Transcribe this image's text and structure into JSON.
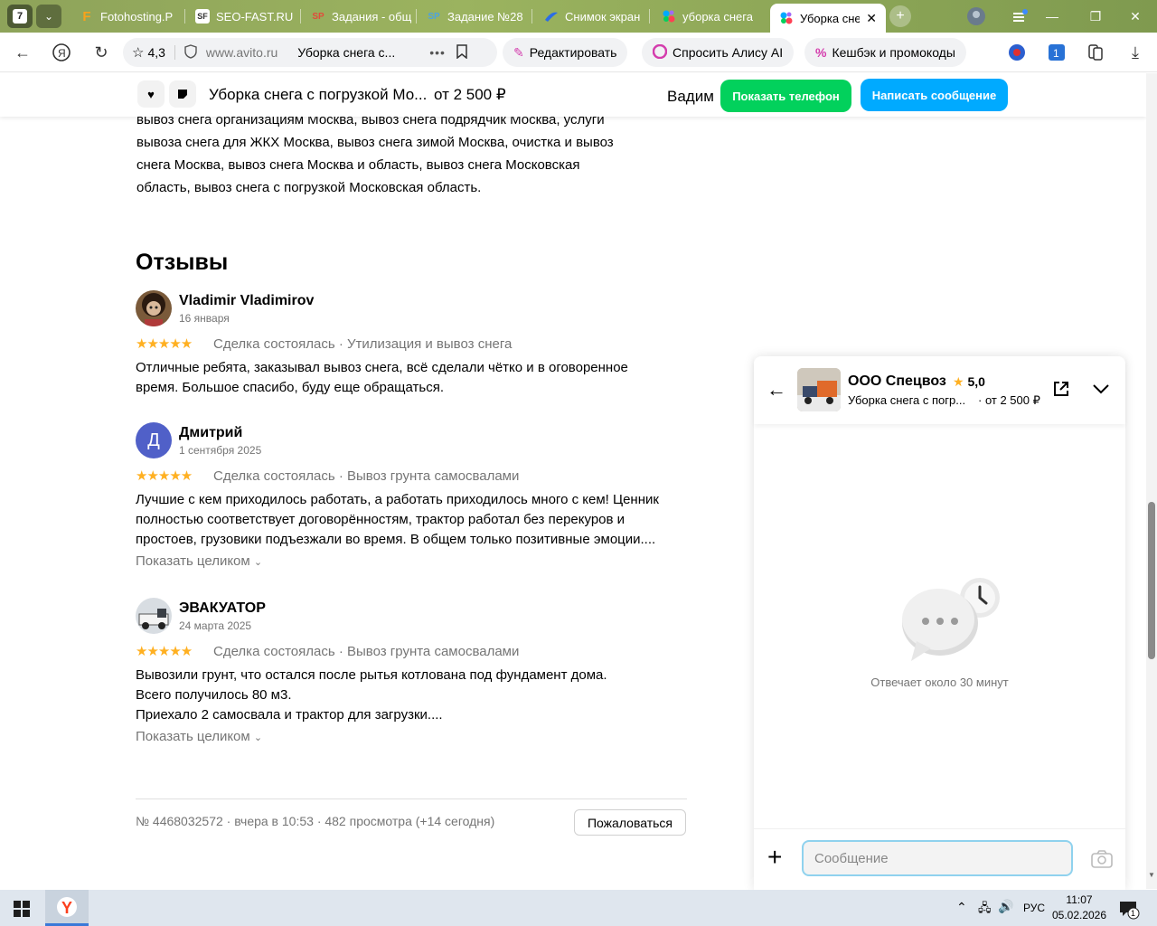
{
  "browser": {
    "tab_count": "7",
    "tabs": [
      {
        "title": "Fotohosting.P",
        "fav": "F",
        "fav_color": "#f7a21b"
      },
      {
        "title": "SEO-FAST.RU",
        "fav": "SF",
        "fav_color": "#ffffff"
      },
      {
        "title": "Задания - общ",
        "fav": "SP",
        "fav_color": "#e24b3b"
      },
      {
        "title": "Задание №28",
        "fav": "SP",
        "fav_color": "#4da3e0"
      },
      {
        "title": "Снимок экран",
        "fav": "",
        "fav_color": "#2b6de6"
      },
      {
        "title": "уборка снега",
        "fav": "",
        "fav_color": "#ffffff"
      },
      {
        "title": "Уборка сне",
        "fav": "",
        "fav_color": "#ffffff"
      }
    ],
    "rating": "4,3",
    "url": "www.avito.ru",
    "page_title": "Уборка снега с...",
    "edit_label": "Редактировать",
    "alice_label": "Спросить Алису AI",
    "cashback_label": "Кешбэк и промокоды"
  },
  "sticky": {
    "title": "Уборка снега с погрузкой Мо...",
    "price": "от 2 500 ₽",
    "seller": "Вадим",
    "show_phone": "Показать телефон",
    "write_message": "Написать сообщение"
  },
  "description": {
    "lines": [
      "вывоз снега организациям Москва, вывоз снега подрядчик Москва, услуги",
      "вывоза снега для ЖКХ Москва, вывоз снега зимой Москва, очистка и вывоз",
      "снега Москва, вывоз снега Москва и область, вывоз снега Московская",
      "область, вывоз снега с погрузкой Московская область."
    ]
  },
  "reviews": {
    "title": "Отзывы",
    "stars": "★★★★★",
    "show_more": "Показать целиком",
    "items": [
      {
        "name": "Vladimir Vladimirov",
        "date": "16 января",
        "deal": "Сделка состоялась · Утилизация и вывоз снега",
        "text": [
          "Отличные ребята, заказывал вывоз снега, всё сделали чётко и в оговоренное",
          "время. Большое спасибо, буду еще обращаться."
        ]
      },
      {
        "name": "Дмитрий",
        "initial": "Д",
        "date": "1 сентября 2025",
        "deal": "Сделка состоялась · Вывоз грунта самосвалами",
        "text": [
          "Лучшие с кем приходилось работать, а работать приходилось много с кем! Ценник",
          "полностью соответствует договорённостям, трактор работал без перекуров и",
          "простоев, грузовики подъезжали во время. В общем только позитивные эмоции...."
        ]
      },
      {
        "name": "ЭВАКУАТОР",
        "date": "24 марта 2025",
        "deal": "Сделка состоялась · Вывоз грунта самосвалами",
        "text": [
          "Вывозили грунт, что остался после рытья котлована под фундамент дома.",
          "Всего получилось 80 м3.",
          "Приехало 2 самосвала и трактор для загрузки...."
        ]
      }
    ]
  },
  "footer": {
    "meta": "№ 4468032572 · вчера в 10:53 · 482 просмотра (+14 сегодня)",
    "complain": "Пожаловаться"
  },
  "chat": {
    "company": "ООО Спецвоз",
    "rating": "5,0",
    "item": "Уборка снега с погр...",
    "price": "· от 2 500 ₽",
    "reply_time": "Отвечает около 30 минут",
    "placeholder": "Сообщение"
  },
  "taskbar": {
    "lang": "РУС",
    "time": "11:07",
    "date": "05.02.2026",
    "notif": "1"
  },
  "colors": {
    "green": "#02d15c",
    "blue": "#00aaff",
    "star": "#ffb021"
  }
}
